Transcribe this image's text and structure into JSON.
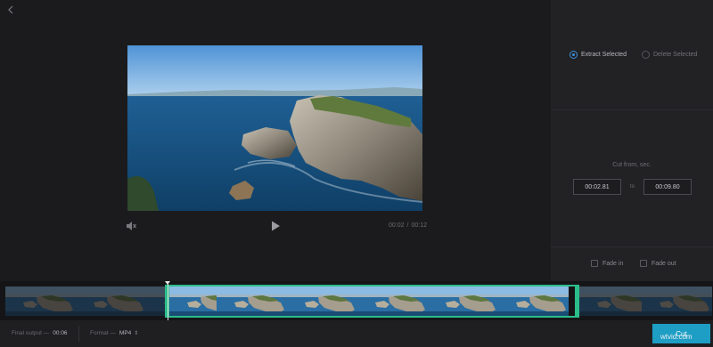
{
  "player": {
    "current_time": "00:02",
    "separator": "/",
    "total_time": "00:12"
  },
  "mode": {
    "options": [
      {
        "label": "Extract Selected",
        "selected": true
      },
      {
        "label": "Delete Selected",
        "selected": false
      }
    ]
  },
  "cut": {
    "title": "Cut from, sec.",
    "from": "00:02.81",
    "to_label": "to",
    "to": "00:09.80"
  },
  "fade": {
    "fade_in": "Fade in",
    "fade_out": "Fade out"
  },
  "footer": {
    "final_output_label": "Final output —",
    "final_output_value": "00:06",
    "format_label": "Format —",
    "format_value": "MP4",
    "cut_button": "Cut"
  },
  "watermark": "wtvid.com",
  "colors": {
    "accent": "#1e9ec4",
    "selection": "#2bbd8a",
    "radio_active": "#3d8fd8"
  },
  "icons": [
    "back-arrow-icon",
    "mute-icon",
    "play-icon",
    "radio-icon",
    "checkbox-icon",
    "chevron-updown-icon"
  ]
}
